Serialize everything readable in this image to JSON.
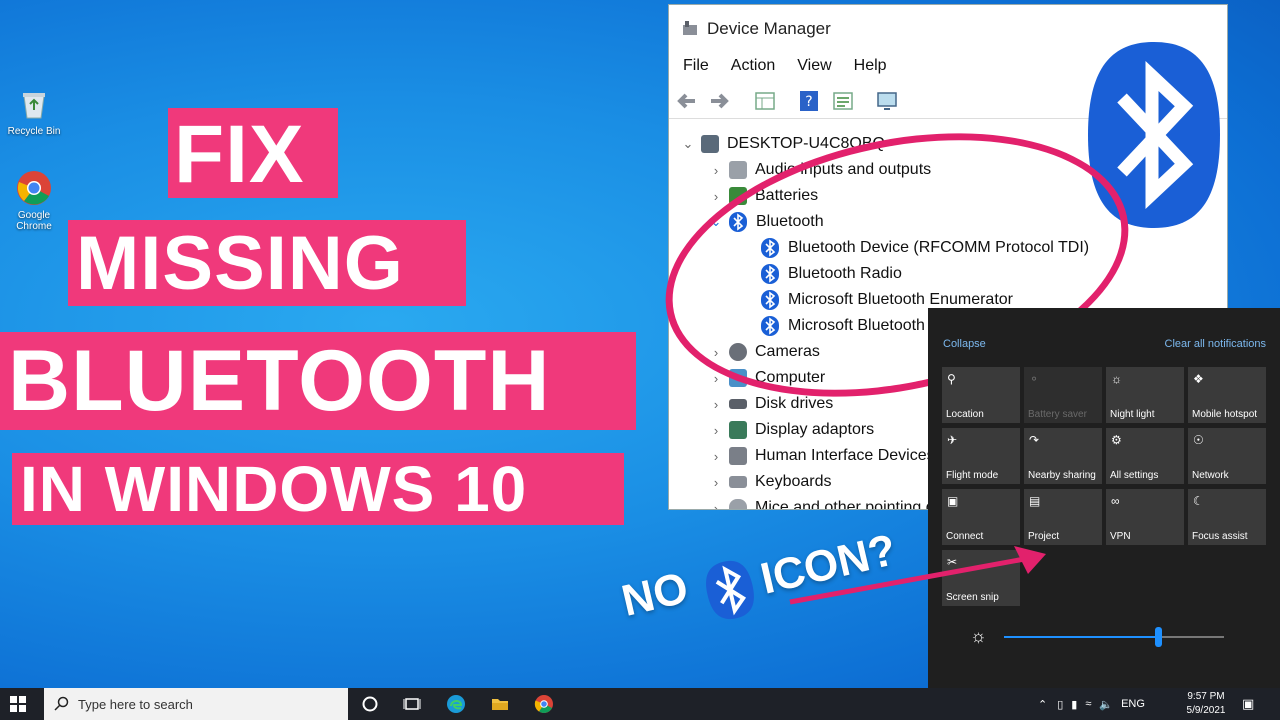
{
  "desktop": {
    "icons": [
      {
        "label": "Recycle Bin",
        "icon": "recycle-bin-icon"
      },
      {
        "label": "Google Chrome",
        "icon": "chrome-icon"
      }
    ]
  },
  "title": {
    "line1": "FIX",
    "line2": "MISSING",
    "line3": "BLUETOOTH",
    "line4": "IN WINDOWS 10"
  },
  "device_manager": {
    "window_title": "Device Manager",
    "menu": [
      "File",
      "Action",
      "View",
      "Help"
    ],
    "root": "DESKTOP-U4C8OBQ",
    "tree": [
      {
        "label": "Audio inputs and outputs",
        "expanded": false,
        "level": 1
      },
      {
        "label": "Batteries",
        "expanded": false,
        "level": 1
      },
      {
        "label": "Bluetooth",
        "expanded": true,
        "level": 1
      },
      {
        "label": "Bluetooth Device (RFCOMM Protocol TDI)",
        "level": 2
      },
      {
        "label": "Bluetooth Radio",
        "level": 2
      },
      {
        "label": "Microsoft Bluetooth Enumerator",
        "level": 2
      },
      {
        "label": "Microsoft Bluetooth LE Enumerator",
        "level": 2
      },
      {
        "label": "Cameras",
        "expanded": false,
        "level": 1
      },
      {
        "label": "Computer",
        "expanded": false,
        "level": 1
      },
      {
        "label": "Disk drives",
        "expanded": false,
        "level": 1
      },
      {
        "label": "Display adaptors",
        "expanded": false,
        "level": 1
      },
      {
        "label": "Human Interface Devices",
        "expanded": false,
        "level": 1
      },
      {
        "label": "Keyboards",
        "expanded": false,
        "level": 1
      },
      {
        "label": "Mice and other pointing devices",
        "expanded": false,
        "level": 1
      }
    ]
  },
  "action_center": {
    "collapse": "Collapse",
    "clear_all": "Clear all notifications",
    "tiles": [
      {
        "label": "Location",
        "icon": "location-icon",
        "enabled": true
      },
      {
        "label": "Battery saver",
        "icon": "battery-saver-icon",
        "enabled": false
      },
      {
        "label": "Night light",
        "icon": "night-light-icon",
        "enabled": true
      },
      {
        "label": "Mobile hotspot",
        "icon": "mobile-hotspot-icon",
        "enabled": true
      },
      {
        "label": "Flight mode",
        "icon": "airplane-icon",
        "enabled": true
      },
      {
        "label": "Nearby sharing",
        "icon": "nearby-sharing-icon",
        "enabled": true
      },
      {
        "label": "All settings",
        "icon": "gear-icon",
        "enabled": true
      },
      {
        "label": "Network",
        "icon": "network-icon",
        "enabled": true
      },
      {
        "label": "Connect",
        "icon": "connect-icon",
        "enabled": true
      },
      {
        "label": "Project",
        "icon": "project-icon",
        "enabled": true
      },
      {
        "label": "VPN",
        "icon": "vpn-icon",
        "enabled": true
      },
      {
        "label": "Focus assist",
        "icon": "moon-icon",
        "enabled": true
      },
      {
        "label": "Screen snip",
        "icon": "scissors-icon",
        "enabled": true
      }
    ],
    "brightness": 0.7
  },
  "callout": {
    "no": "NO",
    "icon": "ICON?"
  },
  "taskbar": {
    "search_placeholder": "Type here to search",
    "language": "ENG",
    "time": "9:57 PM",
    "date": "5/9/2021"
  },
  "colors": {
    "accent_pink": "#f0397b",
    "bluetooth_blue": "#1a5fd6",
    "desktop_blue": "#1a8ee4"
  }
}
